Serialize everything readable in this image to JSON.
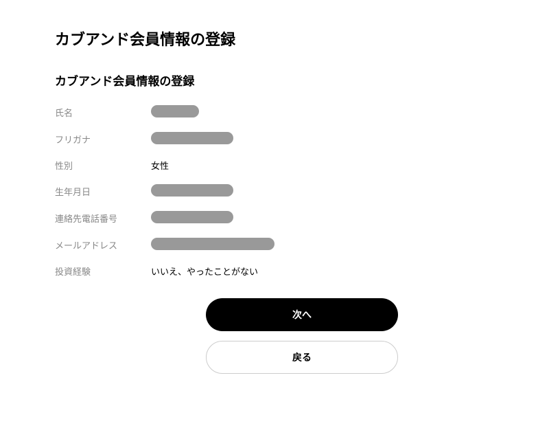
{
  "page_title": "カブアンド会員情報の登録",
  "section_title": "カブアンド会員情報の登録",
  "labels": {
    "name": "氏名",
    "furigana": "フリガナ",
    "gender": "性別",
    "birthdate": "生年月日",
    "phone": "連絡先電話番号",
    "email": "メールアドレス",
    "investment_experience": "投資経験"
  },
  "values": {
    "gender": "女性",
    "investment_experience": "いいえ、やったことがない"
  },
  "buttons": {
    "next": "次へ",
    "back": "戻る"
  }
}
